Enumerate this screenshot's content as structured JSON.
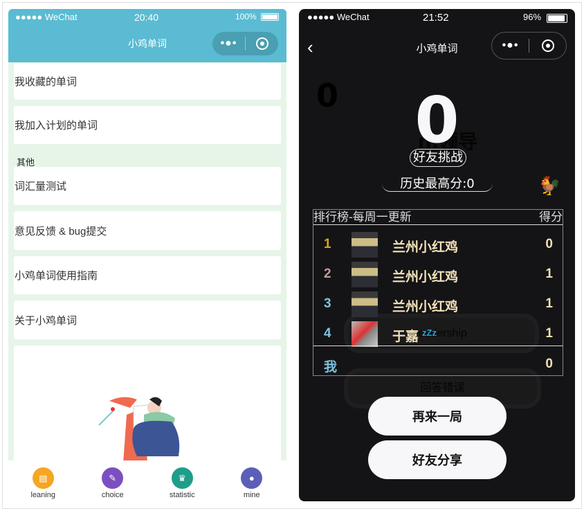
{
  "left_phone": {
    "status": {
      "carrier": "●●●●● WeChat",
      "time": "20:40",
      "battery": "100%"
    },
    "nav_title": "小鸡单词",
    "capsule": {
      "more": "•●•"
    },
    "items": [
      "我收藏的单词",
      "我加入计划的单词"
    ],
    "section_label": "其他",
    "other_items": [
      "词汇量测试",
      "意见反馈 & bug提交",
      "小鸡单词使用指南",
      "关于小鸡单词"
    ],
    "tabs": [
      {
        "label": "leaning",
        "icon": "notepad-icon",
        "color": "#f5a623"
      },
      {
        "label": "choice",
        "icon": "edit-icon",
        "color": "#7b4fbf"
      },
      {
        "label": "statistic",
        "icon": "trophy-icon",
        "color": "#1e9e8a"
      },
      {
        "label": "mine",
        "icon": "user-icon",
        "color": "#5b5fb8"
      }
    ],
    "accent": "#5abbd2",
    "background": "#e6f5e8"
  },
  "right_phone": {
    "status": {
      "carrier": "●●●●● WeChat",
      "time": "21:52",
      "battery": "96%"
    },
    "nav_title": "小鸡单词",
    "capsule": {
      "more": "•●•"
    },
    "faint_score": "0",
    "score": "0",
    "faint_title": "n.领导",
    "challenge_label": "好友挑战",
    "best_score": "历史最高分:0",
    "leaderboard": {
      "title": "排行榜-每周一更新",
      "score_header": "得分",
      "rows": [
        {
          "rank": "1",
          "name": "兰州小红鸡",
          "score": "0",
          "rank_color": "#d4a42a"
        },
        {
          "rank": "2",
          "name": "兰州小红鸡",
          "score": "1",
          "rank_color": "#c49a9a"
        },
        {
          "rank": "3",
          "name": "兰州小红鸡",
          "score": "1",
          "rank_color": "#7cc4e0"
        },
        {
          "rank": "4",
          "name": "于嘉",
          "score": "1",
          "rank_color": "#7cc4e0"
        }
      ],
      "me": {
        "rank": "我",
        "score": "0"
      }
    },
    "sleep_badge": "zZz",
    "ghost_option_1": "leadership",
    "ghost_option_2": "回答错误",
    "replay_button": "再来一局",
    "share_button": "好友分享"
  }
}
